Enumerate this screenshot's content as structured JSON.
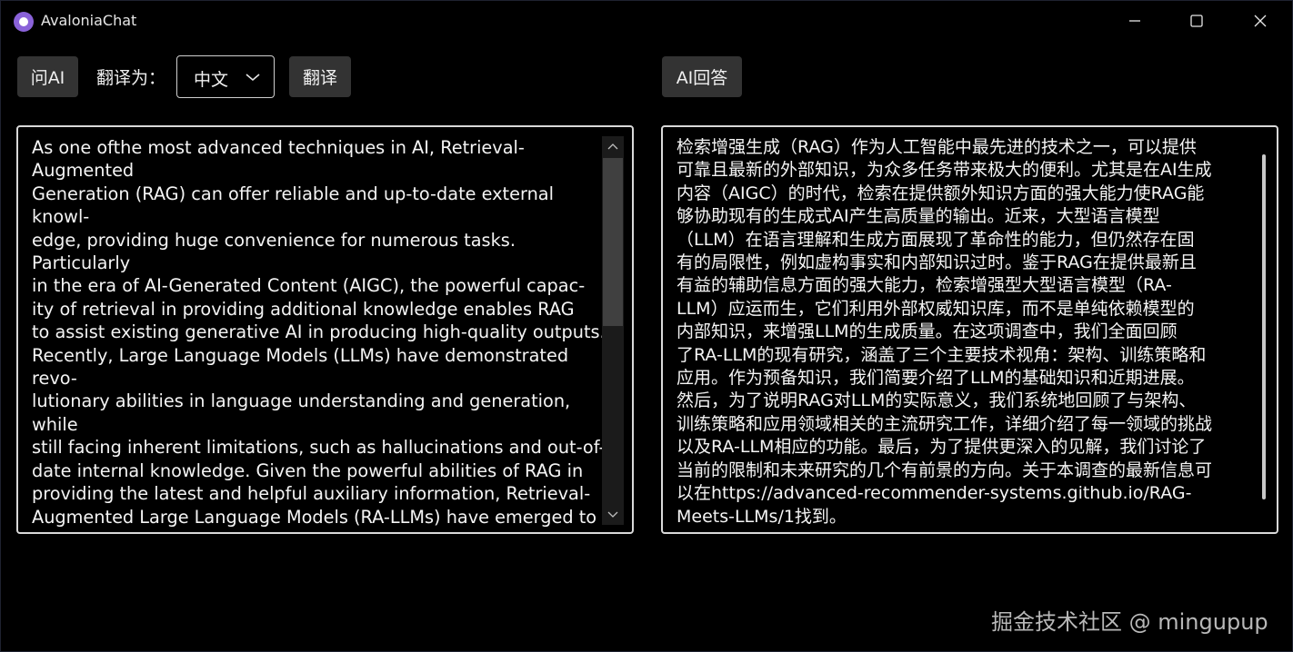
{
  "window": {
    "title": "AvaloniaChat"
  },
  "toolbar": {
    "ask_ai_label": "问AI",
    "translate_to_label": "翻译为：",
    "language_selected": "中文",
    "translate_button_label": "翻译",
    "ai_answer_label": "AI回答"
  },
  "left_panel": {
    "text": "As one ofthe most advanced techniques in AI, Retrieval-\nAugmented\nGeneration (RAG) can offer reliable and up-to-date external\nknowl-\nedge, providing huge convenience for numerous tasks.\nParticularly\nin the era of AI-Generated Content (AIGC), the powerful capac-\nity of retrieval in providing additional knowledge enables RAG\nto assist existing generative AI in producing high-quality outputs.\nRecently, Large Language Models (LLMs) have demonstrated\nrevo-\nlutionary abilities in language understanding and generation,\nwhile\nstill facing inherent limitations, such as hallucinations and out-of-\ndate internal knowledge. Given the powerful abilities of RAG in\nproviding the latest and helpful auxiliary information, Retrieval-\nAugmented Large Language Models (RA-LLMs) have emerged to"
  },
  "right_panel": {
    "text": "检索增强生成（RAG）作为人工智能中最先进的技术之一，可以提供\n可靠且最新的外部知识，为众多任务带来极大的便利。尤其是在AI生成\n内容（AIGC）的时代，检索在提供额外知识方面的强大能力使RAG能\n够协助现有的生成式AI产生高质量的输出。近来，大型语言模型\n（LLM）在语言理解和生成方面展现了革命性的能力，但仍然存在固\n有的局限性，例如虚构事实和内部知识过时。鉴于RAG在提供最新且\n有益的辅助信息方面的强大能力，检索增强型大型语言模型（RA-\nLLM）应运而生，它们利用外部权威知识库，而不是单纯依赖模型的\n内部知识，来增强LLM的生成质量。在这项调查中，我们全面回顾\n了RA-LLM的现有研究，涵盖了三个主要技术视角：架构、训练策略和\n应用。作为预备知识，我们简要介绍了LLM的基础知识和近期进展。\n然后，为了说明RAG对LLM的实际意义，我们系统地回顾了与架构、\n训练策略和应用领域相关的主流研究工作，详细介绍了每一领域的挑战\n以及RA-LLM相应的功能。最后，为了提供更深入的见解，我们讨论了\n当前的限制和未来研究的几个有前景的方向。关于本调查的最新信息可\n以在https://advanced-recommender-systems.github.io/RAG-\nMeets-LLMs/1找到。"
  },
  "watermark": "掘金技术社区 @ mingupup",
  "colors": {
    "background": "#000000",
    "button": "#333333",
    "border": "#d9d9d9",
    "accent": "#8a62d9"
  },
  "icons": {
    "app": "avalonia-logo-icon",
    "minimize": "minimize-icon",
    "maximize": "maximize-icon",
    "close": "close-icon",
    "dropdown": "chevron-down-icon"
  }
}
